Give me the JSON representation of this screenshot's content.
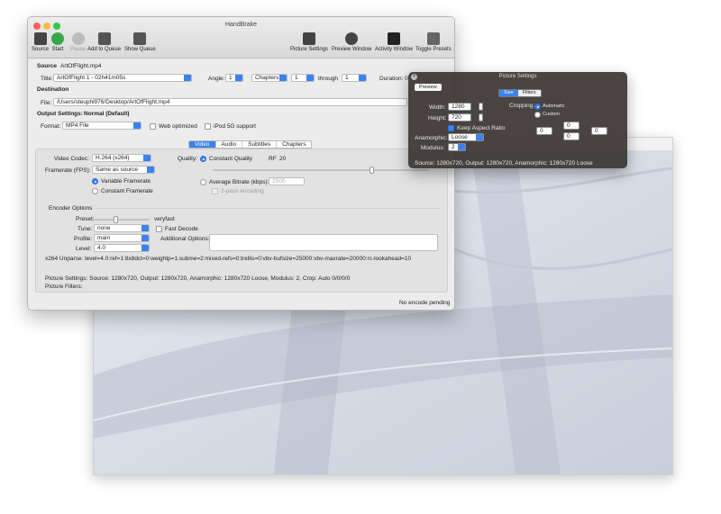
{
  "window": {
    "title": "HandBrake",
    "traffic": [
      "#fc605c",
      "#fdbc40",
      "#34c84a"
    ]
  },
  "toolbar": {
    "source": "Source",
    "start": "Start",
    "pause": "Pause",
    "add_to_queue": "Add to Queue",
    "show_queue": "Show Queue",
    "picture_settings": "Picture Settings",
    "preview_window": "Preview Window",
    "activity_window": "Activity Window",
    "toggle_presets": "Toggle Presets"
  },
  "source": {
    "label": "Source",
    "value": "ArtOfFlight.mp4"
  },
  "title": {
    "label": "Title:",
    "value": "ArtOfFlight 1 - 02h41m05s"
  },
  "angle": {
    "label": "Angle:",
    "value": "1"
  },
  "chapters": {
    "mode": "Chapters",
    "from": "1",
    "through_label": "through",
    "to": "1"
  },
  "duration": {
    "label": "Duration: 0"
  },
  "destination": {
    "heading": "Destination",
    "file_label": "File:",
    "file_value": "/Users/steuphl976/Desktop/ArtOfFlight.mp4"
  },
  "output": {
    "heading": "Output Settings:",
    "preset": "Normal (Default)",
    "format_label": "Format:",
    "format_value": "MP4 File",
    "web_optimized": "Web optimized",
    "ipod_support": "iPod 5G support"
  },
  "tabs": [
    "Video",
    "Audio",
    "Subtitles",
    "Chapters"
  ],
  "video": {
    "codec_label": "Video Codec:",
    "codec_value": "H.264 (x264)",
    "framerate_label": "Framerate (FPS):",
    "framerate_value": "Same as source",
    "variable_framerate": "Variable Framerate",
    "constant_framerate": "Constant Framerate",
    "quality_label": "Quality:",
    "constant_quality": "Constant Quality",
    "rf_label": "RF",
    "rf_value": "20",
    "avg_bitrate": "Average Bitrate (kbps):",
    "bitrate_value": "2500",
    "two_pass": "2-pass encoding",
    "quality_slider_pct": 74
  },
  "encoder": {
    "heading": "Encoder Options",
    "preset_label": "Preset:",
    "preset_value": "veryfast",
    "tune_label": "Tune:",
    "tune_value": "none",
    "fast_decode": "Fast Decode",
    "profile_label": "Profile:",
    "profile_value": "main",
    "additional_options": "Additional Options:",
    "level_label": "Level:",
    "level_value": "4.0",
    "unparse": "x264 Unparse: level=4.0:ref=1:8x8dct=0:weightp=1:subme=2:mixed-refs=0:trellis=0:vbv-bufsize=25000:vbv-maxrate=20000:rc-lookahead=10"
  },
  "summary": {
    "picture_settings": "Picture Settings: Source: 1280x720, Output: 1280x720, Anamorphic: 1280x720 Loose, Modulus: 2, Crop: Auto 0/0/0/0",
    "picture_filters": "Picture Filters:"
  },
  "status": "No encode pending",
  "picture_panel": {
    "title": "Picture Settings",
    "close": "×",
    "preview_button": "Preview",
    "tabs": [
      "Size",
      "Filters"
    ],
    "width_label": "Width:",
    "width_value": "1280",
    "height_label": "Height:",
    "height_value": "720",
    "keep_aspect": "Keep Aspect Ratio",
    "anamorphic_label": "Anamorphic:",
    "anamorphic_value": "Loose",
    "modulus_label": "Modulus:",
    "modulus_value": "2",
    "cropping_label": "Cropping:",
    "crop_automatic": "Automatic",
    "crop_custom": "Custom",
    "crop_top": "0",
    "crop_left": "0",
    "crop_right": "0",
    "crop_bottom": "0",
    "source_summary": "Source: 1280x720, Output: 1280x720, Anamorphic: 1280x720 Loose"
  }
}
